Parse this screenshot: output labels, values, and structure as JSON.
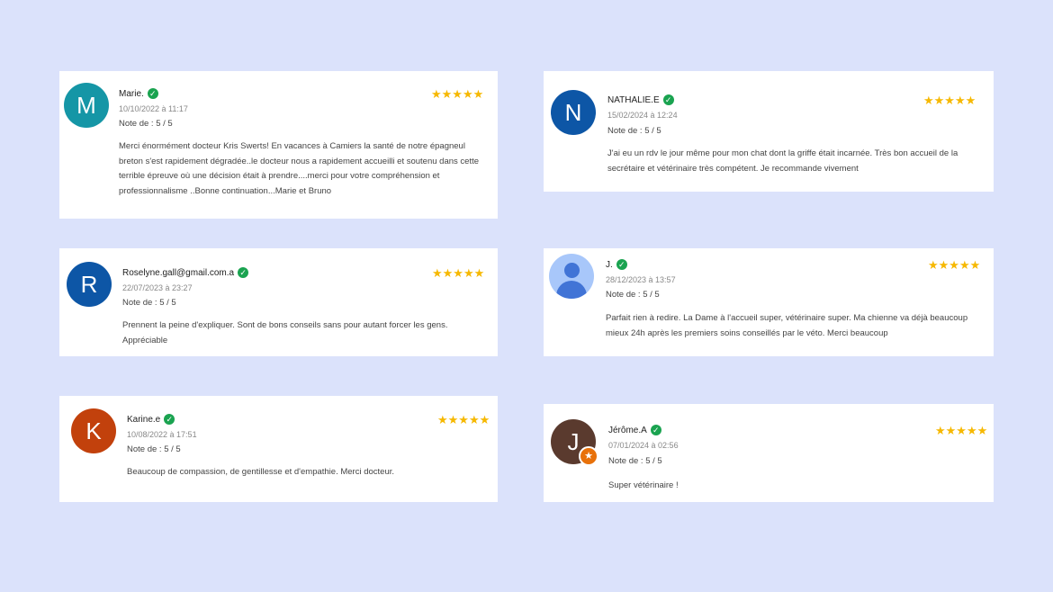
{
  "reviews": [
    {
      "initial": "M",
      "name": "Marie.",
      "date": "10/10/2022 à 11:17",
      "note": "Note de : 5 / 5",
      "stars": "★★★★★",
      "color": "#1596a6",
      "text": "Merci énormément docteur Kris Swerts! En vacances à Camiers la santé de notre épagneul breton s'est rapidement dégradée..le docteur nous a rapidement accueilli et soutenu dans cette terrible épreuve où une décision était à prendre....merci pour votre compréhension et professionnalisme ..Bonne continuation...Marie et Bruno"
    },
    {
      "initial": "N",
      "name": "NATHALIE.E",
      "date": "15/02/2024 à 12:24",
      "note": "Note de : 5 / 5",
      "stars": "★★★★★",
      "color": "#0d56a6",
      "text": "J'ai eu un rdv le jour même pour mon chat dont la griffe était incarnée. Très bon accueil de la secrétaire et vétérinaire très compétent. Je recommande vivement"
    },
    {
      "initial": "R",
      "name": "Roselyne.gall@gmail.com.a",
      "date": "22/07/2023 à 23:27",
      "note": "Note de : 5 / 5",
      "stars": "★★★★★",
      "color": "#0d56a6",
      "text": "Prennent la peine d'expliquer. Sont de bons conseils sans pour autant forcer les gens. Appréciable"
    },
    {
      "initial": "",
      "name": "J.",
      "date": "28/12/2023 à 13:57",
      "note": "Note de : 5 / 5",
      "stars": "★★★★★",
      "color": "#a8c7fa",
      "text": "Parfait rien à redire. La Dame à l'accueil super, vétérinaire super. Ma chienne va déjà beaucoup mieux 24h après les premiers soins conseillés par le véto. Merci beaucoup"
    },
    {
      "initial": "K",
      "name": "Karine.e",
      "date": "10/08/2022 à 17:51",
      "note": "Note de : 5 / 5",
      "stars": "★★★★★",
      "color": "#c2410c",
      "text": "Beaucoup de compassion, de gentillesse et d'empathie. Merci docteur."
    },
    {
      "initial": "J",
      "name": "Jérôme.A",
      "date": "07/01/2024 à 02:56",
      "note": "Note de : 5 / 5",
      "stars": "★★★★★",
      "color": "#5a3a2e",
      "text": "Super vétérinaire !"
    }
  ]
}
